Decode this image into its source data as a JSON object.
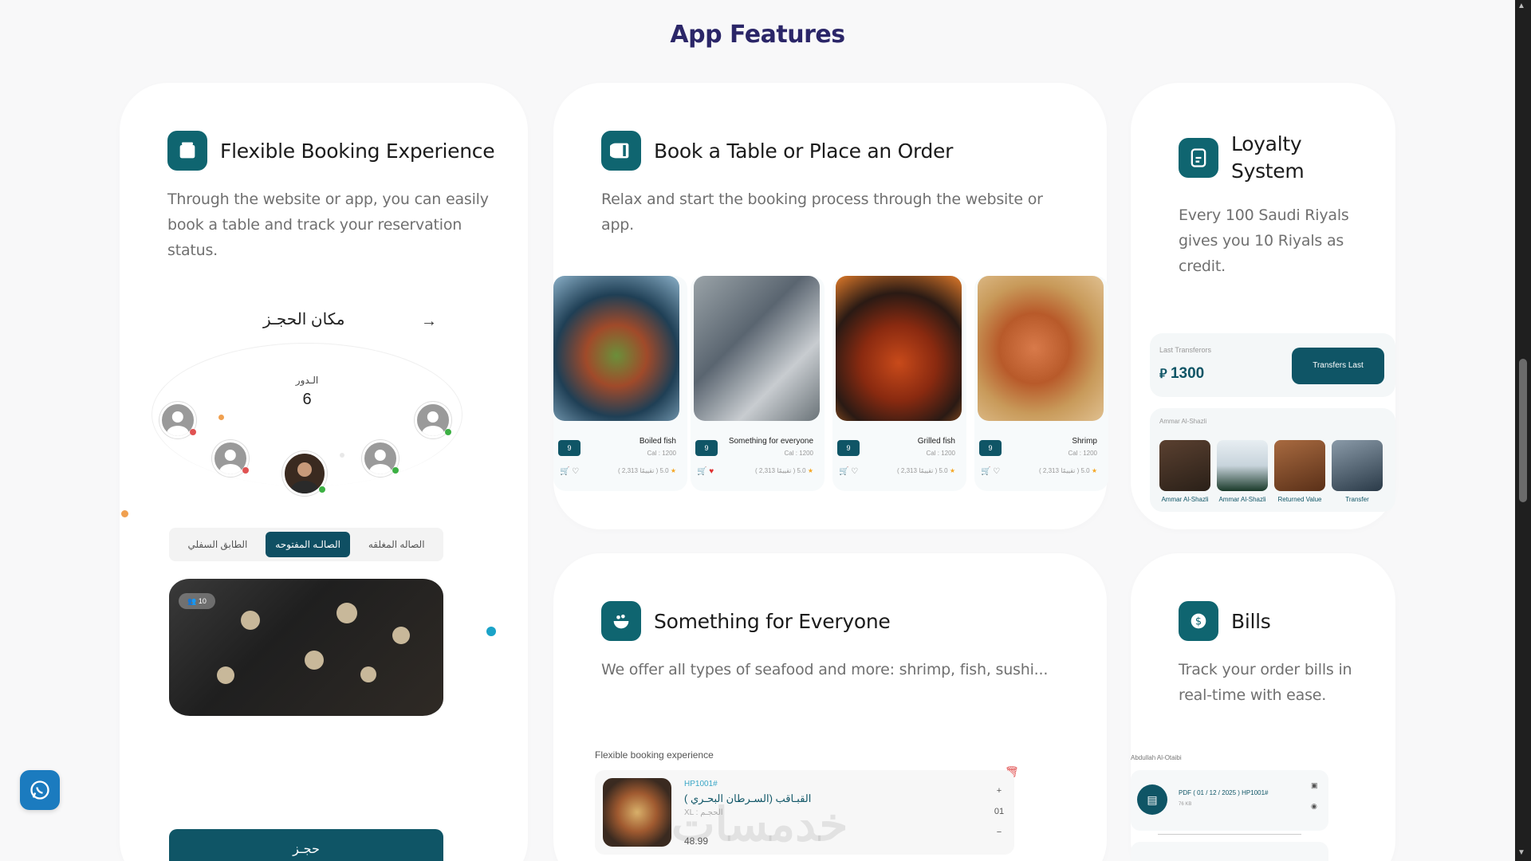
{
  "page": {
    "title": "App Features"
  },
  "cards": {
    "booking": {
      "title": "Flexible Booking Experience",
      "desc": "Through the website or app, you can easily book a table and track your reservation status.",
      "venue_header": "مكان الحجـز",
      "floor_label": "الـدور",
      "floor_value": "6",
      "segments": [
        "الطابق السفلي",
        "الصالـه المفتوحه",
        "الصاله المغلقه"
      ],
      "active_segment": "الصالـه المفتوحه",
      "hall_badge": "👥 10",
      "book_button": "حجـز"
    },
    "order": {
      "title": "Book a Table or Place an Order",
      "desc": "Relax and start the booking process through the website or app.",
      "items": [
        {
          "name": "Boiled fish",
          "cal": "Cal : 1200",
          "price": "9",
          "rating": "( 2,313 تقييمًا ) 5.0"
        },
        {
          "name": "Something for everyone",
          "cal": "Cal : 1200",
          "price": "9",
          "rating": "( 2,313 تقييمًا ) 5.0"
        },
        {
          "name": "Grilled fish",
          "cal": "Cal : 1200",
          "price": "9",
          "rating": "( 2,313 تقييمًا ) 5.0"
        },
        {
          "name": "Shrimp",
          "cal": "Cal : 1200",
          "price": "9",
          "rating": "( 2,313 تقييمًا ) 5.0"
        }
      ]
    },
    "loyalty": {
      "title": "Loyalty System",
      "desc": "Every 100 Saudi Riyals gives you 10 Riyals as credit.",
      "transfers_label": "Last Transferors",
      "amount": "1300",
      "transfers_button": "Transfers Last",
      "people_label": "Ammar Al-Shazli",
      "people": [
        "Ammar Al-Shazli",
        "Ammar Al-Shazli",
        "Returned Value",
        "Transfer"
      ]
    },
    "everyone": {
      "title": "Something for Everyone",
      "desc": "We offer all types of seafood and more: shrimp, fish, sushi...",
      "order_label": "Flexible booking experience",
      "order_id": "HP1001#",
      "order_name": "القبـاقب (السـرطان البحـري )",
      "order_size": "XL : الحجـم",
      "order_price": "48.99",
      "qty": "01",
      "watermark": "خدمسات"
    },
    "bills": {
      "title": "Bills",
      "desc": "Track your order bills in real-time with ease.",
      "user": "Abdullah Al-Otaibi",
      "bill_text": "PDF ( 01 / 12 / 2025 ) HP1001#",
      "bill_size": "76 KB"
    }
  },
  "colors": {
    "accent": "#0f5566",
    "title": "#2b2668"
  }
}
